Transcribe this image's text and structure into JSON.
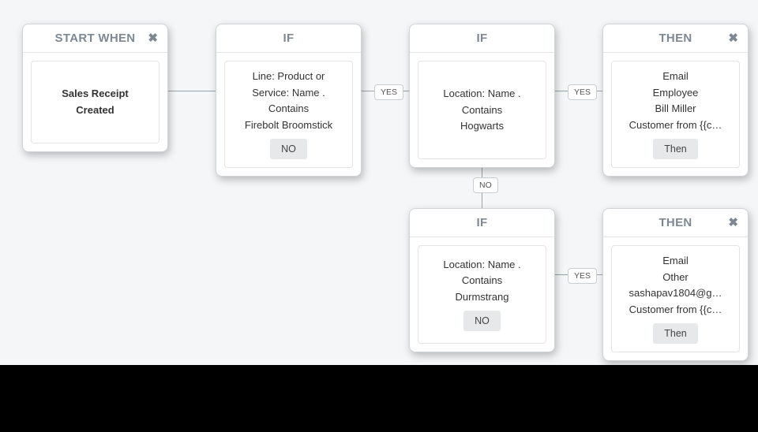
{
  "nodes": {
    "start": {
      "title": "START WHEN",
      "close": "✖",
      "body": [
        "Sales Receipt",
        "Created"
      ]
    },
    "if1": {
      "title": "IF",
      "body": [
        "Line: Product or",
        "Service: Name .",
        "Contains",
        "Firebolt Broomstick"
      ],
      "btn": "NO"
    },
    "if2": {
      "title": "IF",
      "body": [
        "Location: Name .",
        "Contains",
        "Hogwarts"
      ]
    },
    "then1": {
      "title": "THEN",
      "close": "✖",
      "body": [
        "Email",
        "Employee",
        "Bill Miller",
        "Customer from {{c…"
      ],
      "btn": "Then"
    },
    "if3": {
      "title": "IF",
      "body": [
        "Location: Name .",
        "Contains",
        "Durmstrang"
      ],
      "btn": "NO"
    },
    "then2": {
      "title": "THEN",
      "close": "✖",
      "body": [
        "Email",
        "Other",
        "sashapav1804@g…",
        "Customer from {{c…"
      ],
      "btn": "Then"
    }
  },
  "badges": {
    "yes1": "YES",
    "yes2": "YES",
    "no2": "NO",
    "yes3": "YES"
  }
}
